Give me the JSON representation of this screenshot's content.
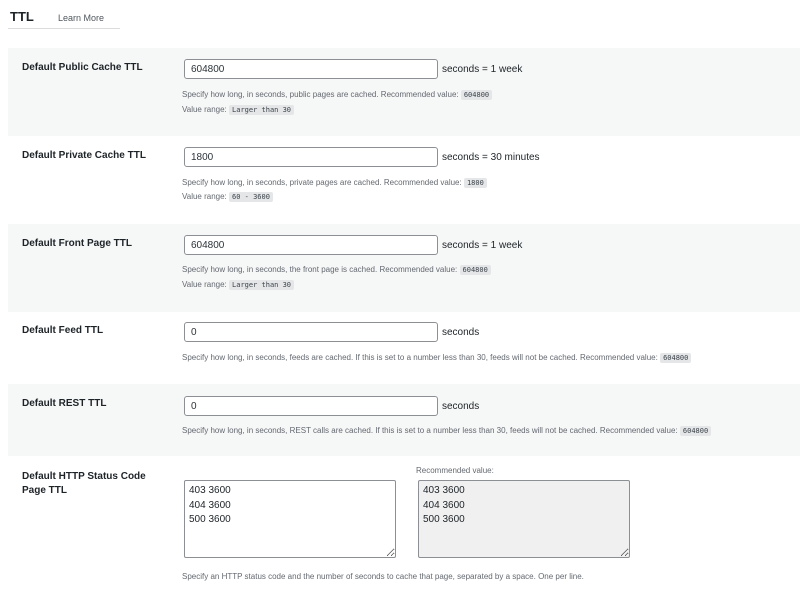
{
  "tabs": {
    "active": "TTL",
    "link": "Learn More"
  },
  "rows": [
    {
      "label": "Default Public Cache TTL",
      "value": "604800",
      "unit": "seconds = 1 week",
      "desc": "Specify how long, in seconds, public pages are cached. Recommended value:",
      "recommended": "604800",
      "range_label": "Value range:",
      "range": "Larger than 30"
    },
    {
      "label": "Default Private Cache TTL",
      "value": "1800",
      "unit": "seconds = 30 minutes",
      "desc": "Specify how long, in seconds, private pages are cached. Recommended value:",
      "recommended": "1800",
      "range_label": "Value range:",
      "range": "60 - 3600"
    },
    {
      "label": "Default Front Page TTL",
      "value": "604800",
      "unit": "seconds = 1 week",
      "desc": "Specify how long, in seconds, the front page is cached. Recommended value:",
      "recommended": "604800",
      "range_label": "Value range:",
      "range": "Larger than 30"
    },
    {
      "label": "Default Feed TTL",
      "value": "0",
      "unit": "seconds",
      "desc": "Specify how long, in seconds, feeds are cached. If this is set to a number less than 30, feeds will not be cached. Recommended value:",
      "recommended": "604800"
    },
    {
      "label": "Default REST TTL",
      "value": "0",
      "unit": "seconds",
      "desc": "Specify how long, in seconds, REST calls are cached. If this is set to a number less than 30, feeds will not be cached. Recommended value:",
      "recommended": "604800"
    }
  ],
  "status": {
    "label": "Default HTTP Status Code Page TTL",
    "value": "403 3600\n404 3600\n500 3600",
    "recommended_label": "Recommended value:",
    "recommended_value": "403 3600\n404 3600\n500 3600",
    "desc": "Specify an HTTP status code and the number of seconds to cache that page, separated by a space. One per line."
  }
}
